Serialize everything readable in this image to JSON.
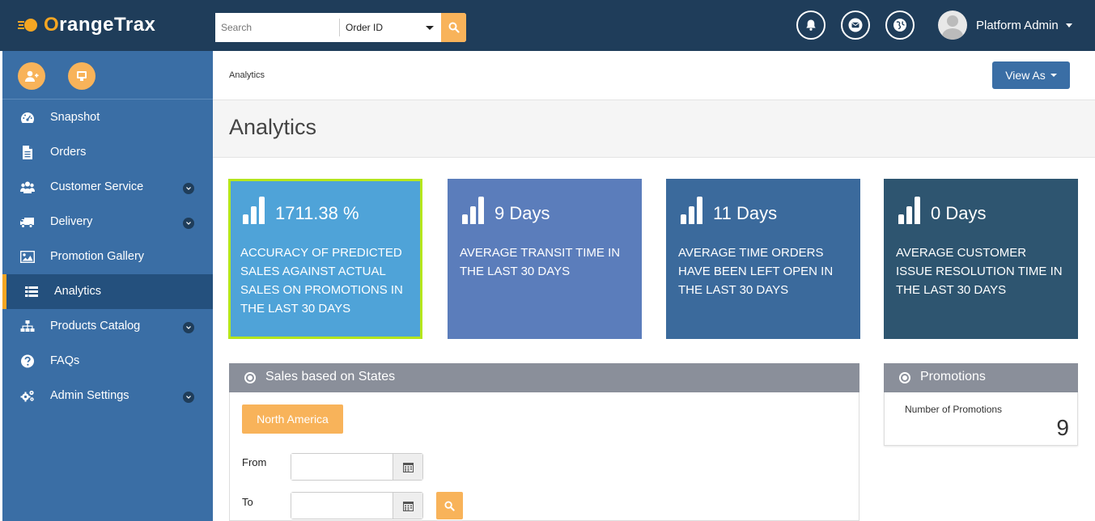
{
  "header": {
    "logo_prefix": "",
    "logo_o": "O",
    "logo_rest": "rangeTrax",
    "search_placeholder": "Search",
    "search_type": "Order ID",
    "user_name": "Platform Admin"
  },
  "sidebar": {
    "items": [
      {
        "label": "Snapshot",
        "icon": "dashboard-icon"
      },
      {
        "label": "Orders",
        "icon": "document-icon"
      },
      {
        "label": "Customer Service",
        "icon": "users-icon"
      },
      {
        "label": "Delivery",
        "icon": "truck-icon"
      },
      {
        "label": "Promotion Gallery",
        "icon": "image-icon"
      },
      {
        "label": "Analytics",
        "icon": "list-icon"
      },
      {
        "label": "Products Catalog",
        "icon": "sitemap-icon"
      },
      {
        "label": "FAQs",
        "icon": "question-icon"
      },
      {
        "label": "Admin Settings",
        "icon": "gears-icon"
      }
    ]
  },
  "breadcrumb": "Analytics",
  "view_as_label": "View As",
  "page_title": "Analytics",
  "kpis": [
    {
      "value": "1711.38 %",
      "desc": "Accuracy of predicted sales against actual sales on promotions in the last 30 days",
      "color": "#4fa3d8"
    },
    {
      "value": "9 Days",
      "desc": "Average transit time in the last 30 days",
      "color": "#5b7dbb"
    },
    {
      "value": "11 Days",
      "desc": "Average time orders have been left open in the last 30 days",
      "color": "#3b6a9c"
    },
    {
      "value": "0 Days",
      "desc": "Average customer issue resolution time in the last 30 days",
      "color": "#2e5570"
    }
  ],
  "sales_panel": {
    "title": "Sales based on States",
    "region_button": "North America",
    "from_label": "From",
    "to_label": "To"
  },
  "promotions_panel": {
    "title": "Promotions",
    "label": "Number of Promotions",
    "count": "9"
  },
  "colors": {
    "topbar": "#1f3d5a",
    "sidebar": "#3a6ea5",
    "accent": "#f8b35a",
    "active_border": "#f5a623",
    "kpi_highlight_border": "#b5e61d"
  }
}
